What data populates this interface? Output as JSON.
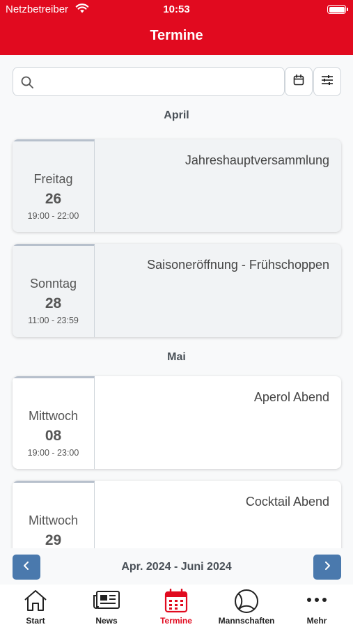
{
  "status_bar": {
    "carrier": "Netzbetreiber",
    "time": "10:53"
  },
  "header": {
    "title": "Termine"
  },
  "search": {
    "placeholder": "",
    "value": ""
  },
  "sections": [
    {
      "month": "April",
      "events": [
        {
          "weekday": "Freitag",
          "day": "26",
          "time": "19:00 - 22:00",
          "title": "Jahreshauptversammlung"
        },
        {
          "weekday": "Sonntag",
          "day": "28",
          "time": "11:00 - 23:59",
          "title": "Saisoneröffnung - Frühschoppen"
        }
      ]
    },
    {
      "month": "Mai",
      "events": [
        {
          "weekday": "Mittwoch",
          "day": "08",
          "time": "19:00 - 23:00",
          "title": "Aperol Abend"
        },
        {
          "weekday": "Mittwoch",
          "day": "29",
          "time": "",
          "title": "Cocktail Abend"
        }
      ]
    }
  ],
  "pager": {
    "label": "Apr. 2024 - Juni 2024"
  },
  "tabbar": {
    "active": "Termine",
    "items": [
      {
        "label": "Start",
        "icon": "home-icon"
      },
      {
        "label": "News",
        "icon": "newspaper-icon"
      },
      {
        "label": "Termine",
        "icon": "calendar-icon"
      },
      {
        "label": "Mannschaften",
        "icon": "tennis-ball-icon"
      },
      {
        "label": "Mehr",
        "icon": "more-dots-icon"
      }
    ]
  },
  "colors": {
    "brand_red": "#e10a1f",
    "pager_blue": "#4a79ad"
  }
}
